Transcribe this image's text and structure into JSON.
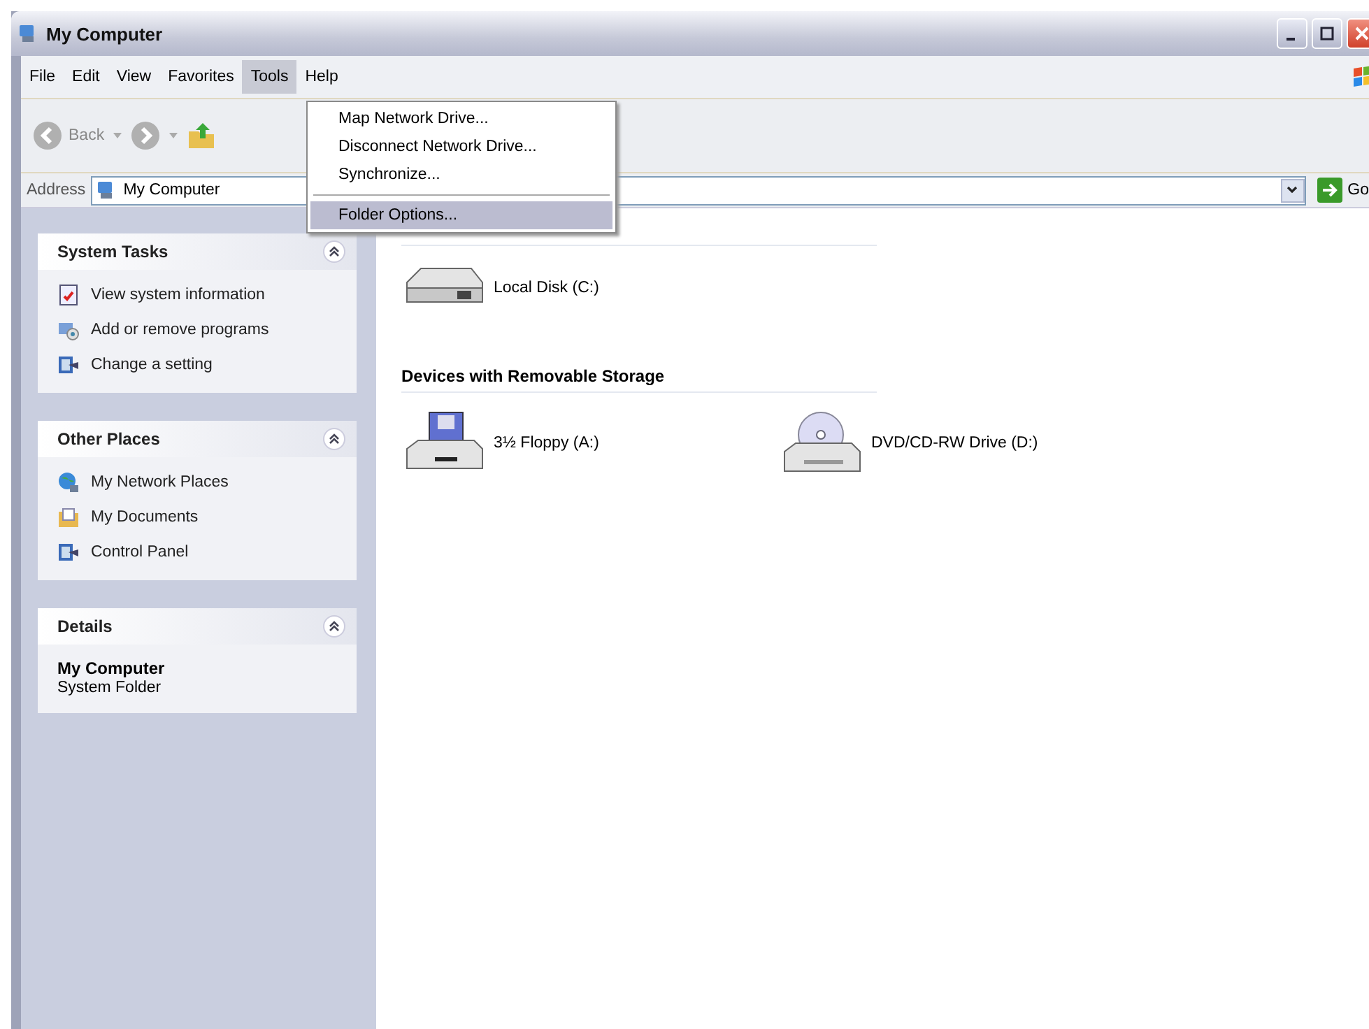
{
  "window": {
    "title": "My Computer"
  },
  "menu": [
    {
      "label": "File",
      "selected": false
    },
    {
      "label": "Edit",
      "selected": false
    },
    {
      "label": "View",
      "selected": false
    },
    {
      "label": "Favorites",
      "selected": false
    },
    {
      "label": "Tools",
      "selected": true
    },
    {
      "label": "Help",
      "selected": false
    }
  ],
  "dropdown": [
    {
      "kind": "item",
      "label": "Map Network Drive...",
      "selected": false
    },
    {
      "kind": "item",
      "label": "Disconnect Network Drive...",
      "selected": false
    },
    {
      "kind": "item",
      "label": "Synchronize...",
      "selected": false
    },
    {
      "kind": "separator"
    },
    {
      "kind": "item",
      "label": "Folder Options...",
      "selected": true
    }
  ],
  "toolbar": {
    "back": "Back"
  },
  "address": {
    "label": "Address",
    "value": "My Computer",
    "go": "Go"
  },
  "panels": [
    {
      "title": "System Tasks",
      "kind": "links",
      "items": [
        {
          "label": "View system information",
          "kind": "info"
        },
        {
          "label": "Add or remove programs",
          "kind": "programs"
        },
        {
          "label": "Change a setting",
          "kind": "panel"
        }
      ]
    },
    {
      "title": "Other Places",
      "kind": "links",
      "items": [
        {
          "label": "My Network Places",
          "kind": "network"
        },
        {
          "label": "My Documents",
          "kind": "documents"
        },
        {
          "label": "Control Panel",
          "kind": "panel"
        }
      ]
    },
    {
      "title": "Details",
      "kind": "details",
      "name": "My Computer",
      "subtitle": "System Folder"
    }
  ],
  "groups": [
    {
      "items": [
        {
          "label": "Local Disk (C:)",
          "kind": "harddisk"
        }
      ]
    },
    {
      "heading": "Devices with Removable Storage",
      "items": [
        {
          "label": "3½ Floppy (A:)",
          "kind": "floppy"
        },
        {
          "label": "DVD/CD-RW Drive (D:)",
          "kind": "dvd"
        }
      ]
    }
  ]
}
